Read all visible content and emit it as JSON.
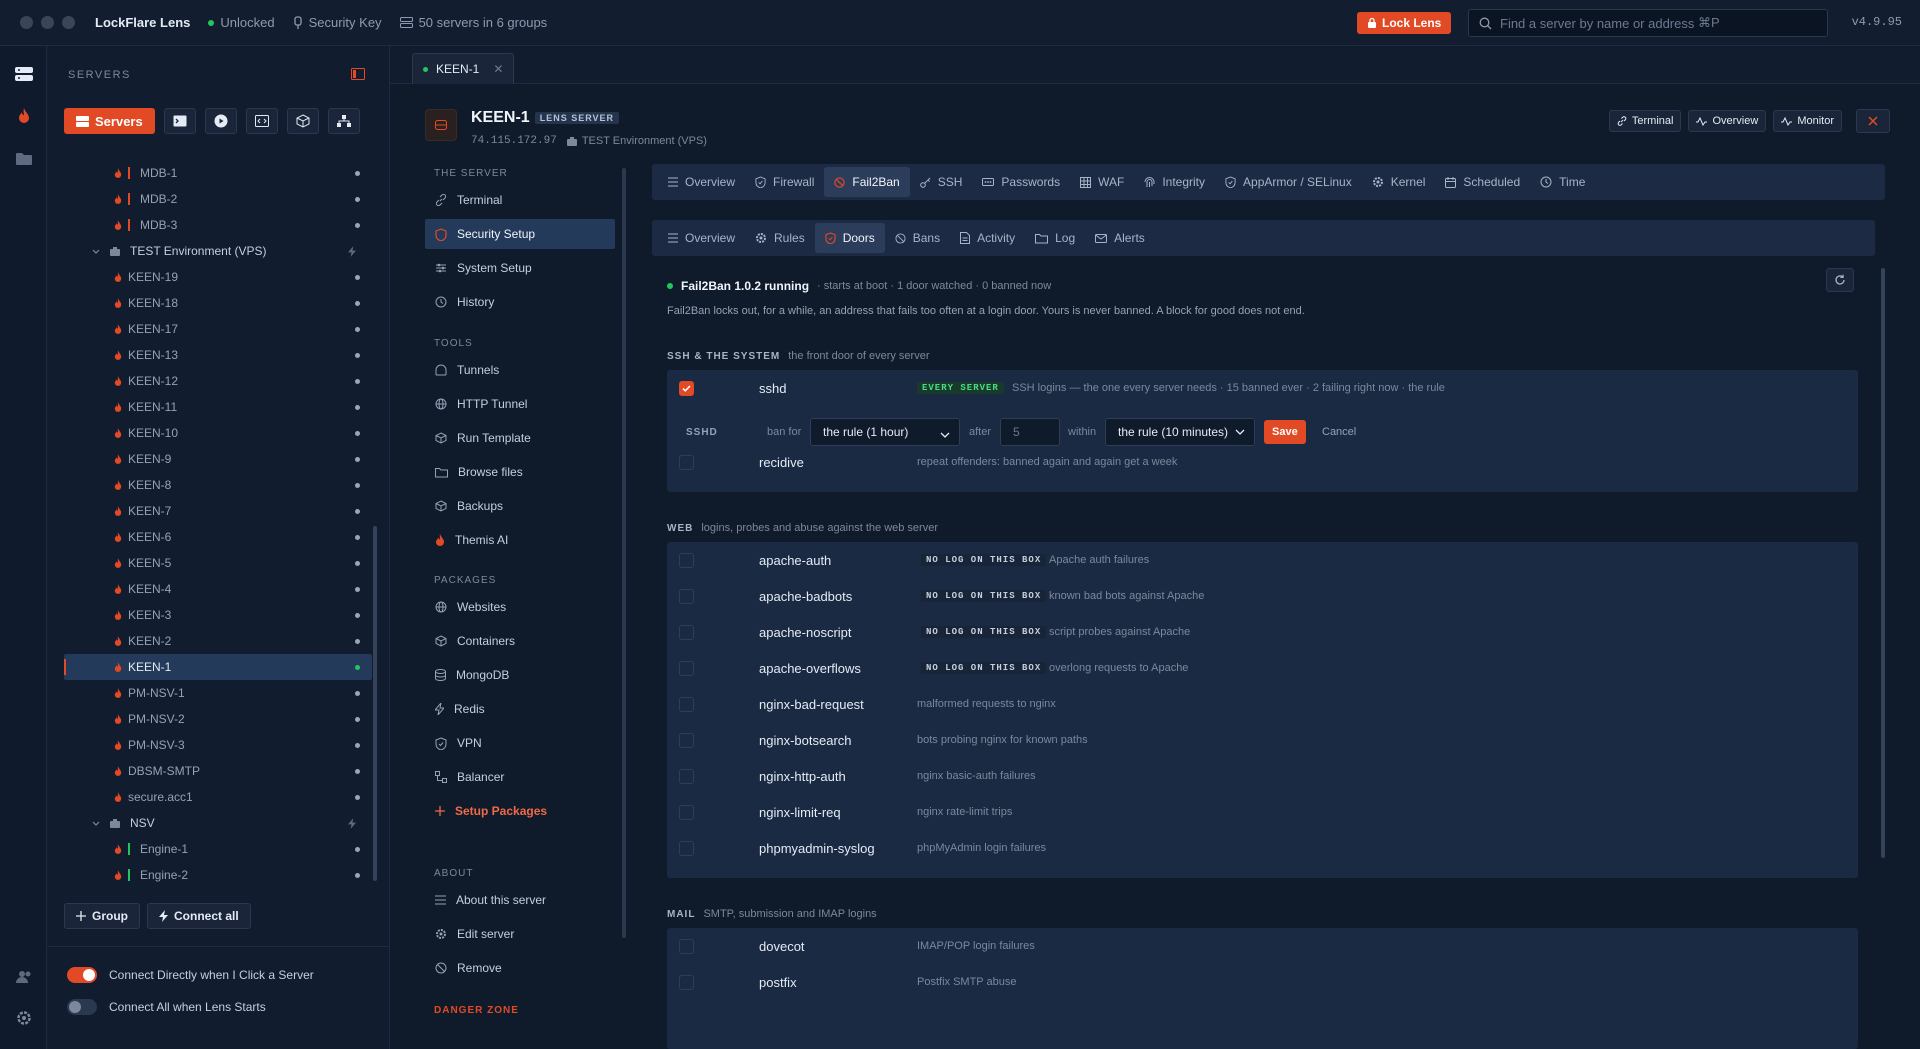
{
  "app": {
    "name": "LockFlare Lens",
    "status": "Unlocked",
    "key": "Security Key",
    "servers_summary": "50 servers in 6 groups",
    "lock_label": "Lock Lens",
    "search_placeholder": "Find a server by name or address",
    "search_shortcut": "⌘P",
    "version": "v4.9.95"
  },
  "sidebar": {
    "title": "SERVERS",
    "servers_btn": "Servers",
    "tree": [
      {
        "kind": "server",
        "name": "MDB-1",
        "tag": "#e24a26"
      },
      {
        "kind": "server",
        "name": "MDB-2",
        "tag": "#e24a26"
      },
      {
        "kind": "server",
        "name": "MDB-3",
        "tag": "#e24a26"
      },
      {
        "kind": "group",
        "name": "TEST Environment (VPS)"
      },
      {
        "kind": "server",
        "name": "KEEN-19"
      },
      {
        "kind": "server",
        "name": "KEEN-18"
      },
      {
        "kind": "server",
        "name": "KEEN-17"
      },
      {
        "kind": "server",
        "name": "KEEN-13"
      },
      {
        "kind": "server",
        "name": "KEEN-12"
      },
      {
        "kind": "server",
        "name": "KEEN-11"
      },
      {
        "kind": "server",
        "name": "KEEN-10"
      },
      {
        "kind": "server",
        "name": "KEEN-9"
      },
      {
        "kind": "server",
        "name": "KEEN-8"
      },
      {
        "kind": "server",
        "name": "KEEN-7"
      },
      {
        "kind": "server",
        "name": "KEEN-6"
      },
      {
        "kind": "server",
        "name": "KEEN-5"
      },
      {
        "kind": "server",
        "name": "KEEN-4"
      },
      {
        "kind": "server",
        "name": "KEEN-3"
      },
      {
        "kind": "server",
        "name": "KEEN-2"
      },
      {
        "kind": "server",
        "name": "KEEN-1",
        "selected": true
      },
      {
        "kind": "server",
        "name": "PM-NSV-1"
      },
      {
        "kind": "server",
        "name": "PM-NSV-2"
      },
      {
        "kind": "server",
        "name": "PM-NSV-3"
      },
      {
        "kind": "server",
        "name": "DBSM-SMTP"
      },
      {
        "kind": "server",
        "name": "secure.acc1"
      },
      {
        "kind": "group",
        "name": "NSV"
      },
      {
        "kind": "server",
        "name": "Engine-1",
        "tag": "#22c55e"
      },
      {
        "kind": "server",
        "name": "Engine-2",
        "tag": "#22c55e"
      }
    ],
    "group_btn": "Group",
    "connect_all_btn": "Connect all",
    "toggle1": "Connect Directly when I Click a Server",
    "toggle2": "Connect All when Lens Starts"
  },
  "tab": {
    "name": "KEEN-1"
  },
  "server": {
    "name": "KEEN-1",
    "badge": "LENS SERVER",
    "ip": "74.115.172.97",
    "group": "TEST Environment (VPS)",
    "btn_terminal": "Terminal",
    "btn_overview": "Overview",
    "btn_monitor": "Monitor"
  },
  "nav": {
    "sec_server": "THE SERVER",
    "terminal": "Terminal",
    "security_setup": "Security Setup",
    "system_setup": "System Setup",
    "history": "History",
    "sec_tools": "TOOLS",
    "tunnels": "Tunnels",
    "http_tunnel": "HTTP Tunnel",
    "run_template": "Run Template",
    "browse_files": "Browse files",
    "backups": "Backups",
    "themis_ai": "Themis AI",
    "sec_packages": "PACKAGES",
    "websites": "Websites",
    "containers": "Containers",
    "mongodb": "MongoDB",
    "redis": "Redis",
    "vpn": "VPN",
    "balancer": "Balancer",
    "setup_packages": "Setup Packages",
    "sec_about": "ABOUT",
    "about": "About this server",
    "edit": "Edit server",
    "remove": "Remove",
    "danger": "DANGER ZONE"
  },
  "tabs": [
    "Overview",
    "Firewall",
    "Fail2Ban",
    "SSH",
    "Passwords",
    "WAF",
    "Integrity",
    "AppArmor / SELinux",
    "Kernel",
    "Scheduled",
    "Time"
  ],
  "subtabs": [
    "Overview",
    "Rules",
    "Doors",
    "Bans",
    "Activity",
    "Log",
    "Alerts"
  ],
  "fail2ban": {
    "running": "Fail2Ban 1.0.2 running",
    "meta": "· starts at boot · 1 door watched · 0 banned now",
    "desc": "Fail2Ban locks out, for a while, an address that fails too often at a login door. Yours is never banned. A block for good does not end.",
    "ssh_head": "SSH & THE SYSTEM",
    "ssh_sub": "the front door of every server",
    "sshd_name": "sshd",
    "sshd_badge": "EVERY SERVER",
    "sshd_desc": "SSH logins — the one every server needs · 15 banned ever · 2 failing right now · the rule",
    "edit_label": "SSHD",
    "ban_for": "ban for",
    "ban_value": "the rule (1 hour)",
    "after": "after",
    "after_value": "5",
    "within": "within",
    "within_value": "the rule (10 minutes)",
    "save": "Save",
    "cancel": "Cancel",
    "recidive_name": "recidive",
    "recidive_desc": "repeat offenders: banned again and again get a week",
    "web_head": "WEB",
    "web_sub": "logins, probes and abuse against the web server",
    "nolog": "NO LOG ON THIS BOX",
    "web_jails": [
      {
        "name": "apache-auth",
        "desc": "Apache auth failures",
        "nolog": true
      },
      {
        "name": "apache-badbots",
        "desc": "known bad bots against Apache",
        "nolog": true
      },
      {
        "name": "apache-noscript",
        "desc": "script probes against Apache",
        "nolog": true
      },
      {
        "name": "apache-overflows",
        "desc": "overlong requests to Apache",
        "nolog": true
      },
      {
        "name": "nginx-bad-request",
        "desc": "malformed requests to nginx",
        "nolog": false
      },
      {
        "name": "nginx-botsearch",
        "desc": "bots probing nginx for known paths",
        "nolog": false
      },
      {
        "name": "nginx-http-auth",
        "desc": "nginx basic-auth failures",
        "nolog": false
      },
      {
        "name": "nginx-limit-req",
        "desc": "nginx rate-limit trips",
        "nolog": false
      },
      {
        "name": "phpmyadmin-syslog",
        "desc": "phpMyAdmin login failures",
        "nolog": false
      }
    ],
    "mail_head": "MAIL",
    "mail_sub": "SMTP, submission and IMAP logins",
    "mail_jails": [
      {
        "name": "dovecot",
        "desc": "IMAP/POP login failures"
      },
      {
        "name": "postfix",
        "desc": "Postfix SMTP abuse"
      }
    ]
  },
  "colors": {
    "accent": "#e24a26",
    "ok": "#22c55e"
  }
}
